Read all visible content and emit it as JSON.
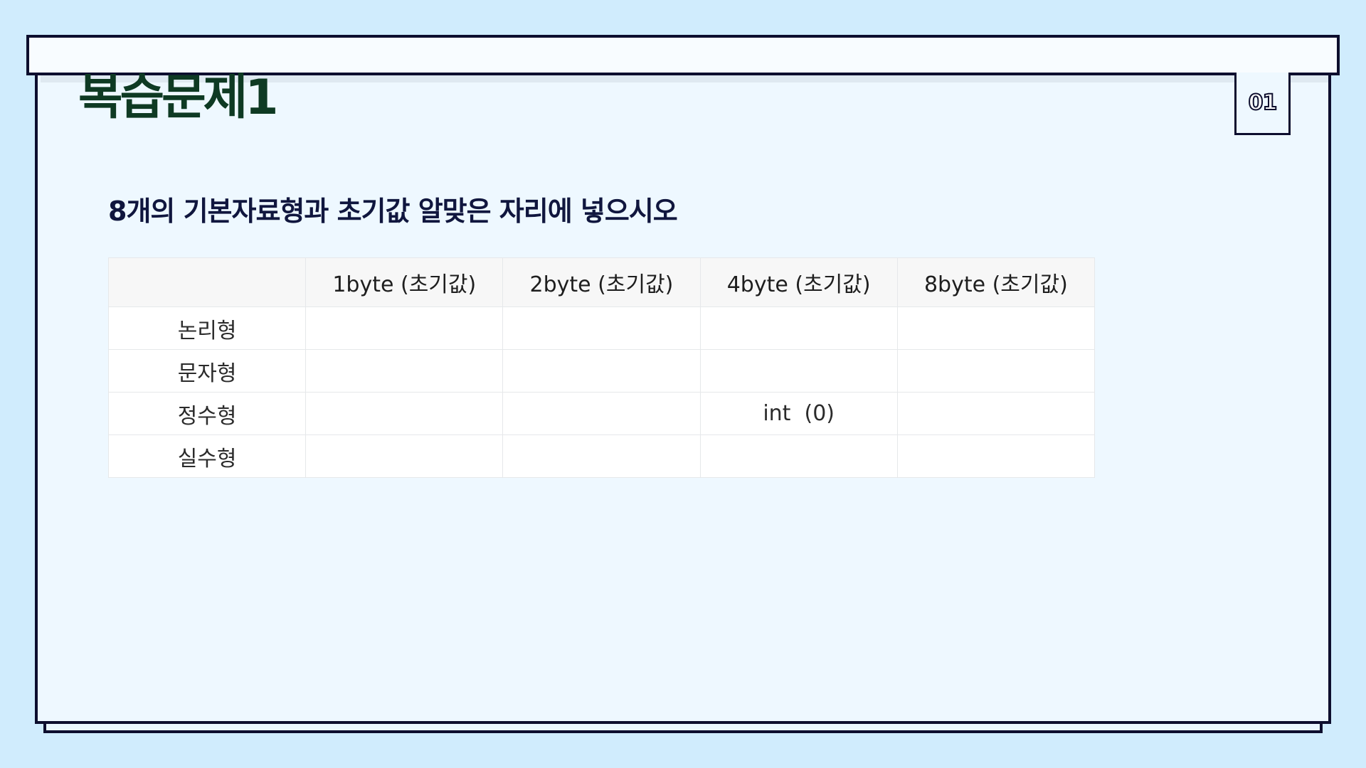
{
  "slide": {
    "title": "복습문제1",
    "page_number": "01",
    "question": "8개의 기본자료형과 초기값 알맞은 자리에 넣으시오"
  },
  "table": {
    "headers": [
      "",
      "1byte (초기값)",
      "2byte (초기값)",
      "4byte (초기값)",
      "8byte (초기값)"
    ],
    "rows": [
      [
        "논리형",
        "",
        "",
        "",
        ""
      ],
      [
        "문자형",
        "",
        "",
        "",
        ""
      ],
      [
        "정수형",
        "",
        "",
        "int  (0)",
        ""
      ],
      [
        "실수형",
        "",
        "",
        "",
        ""
      ]
    ]
  },
  "colors": {
    "background": "#d0ecfd",
    "board": "#eef8ff",
    "border": "#0d0e2e",
    "title": "#0e3a23",
    "question": "#10163e"
  }
}
